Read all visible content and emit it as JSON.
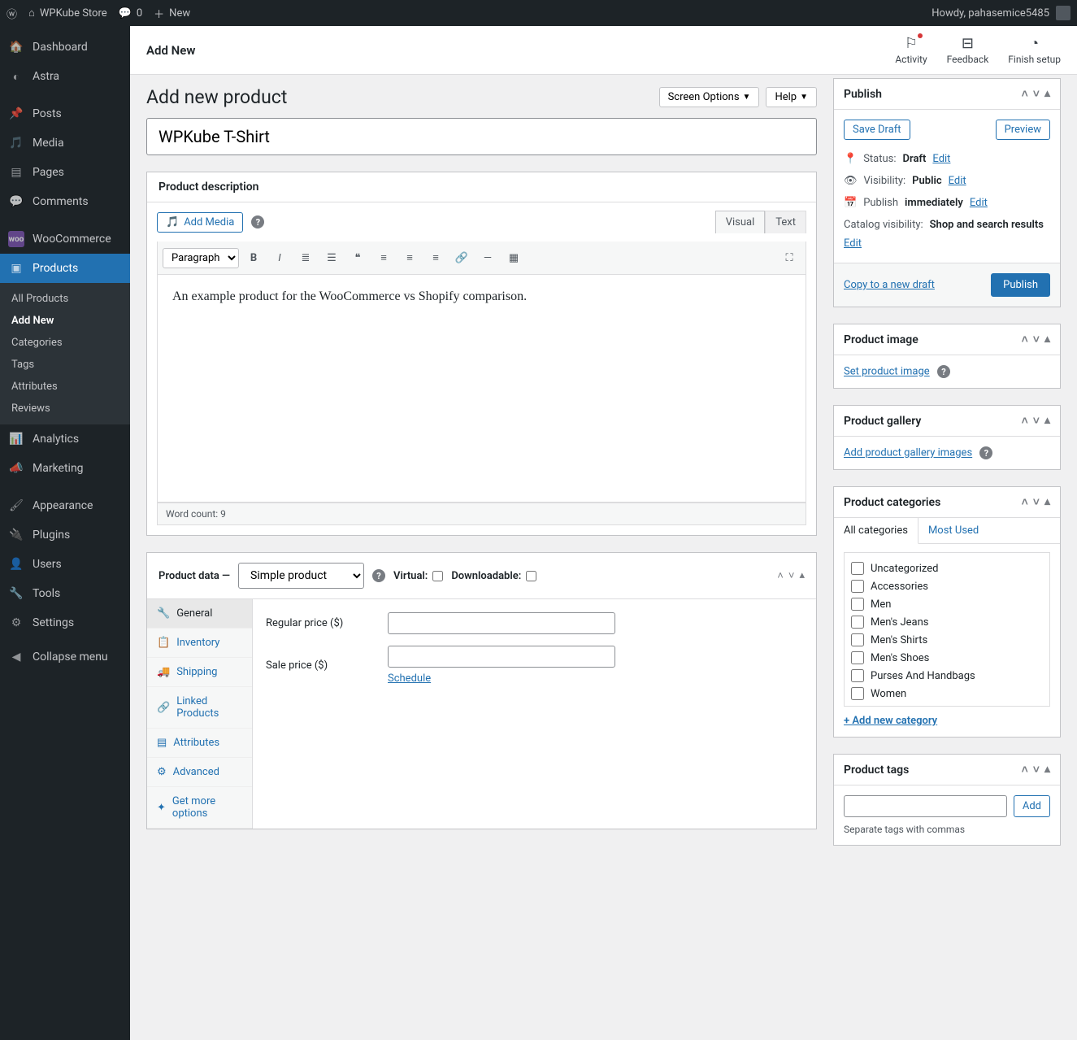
{
  "adminbar": {
    "site_name": "WPKube Store",
    "comments_count": "0",
    "new_label": "New",
    "howdy": "Howdy, pahasemice5485"
  },
  "sidebar": {
    "items": [
      {
        "label": "Dashboard",
        "icon": "⊞"
      },
      {
        "label": "Astra",
        "icon": "◐"
      },
      {
        "label": "Posts",
        "icon": "📌"
      },
      {
        "label": "Media",
        "icon": "🖼"
      },
      {
        "label": "Pages",
        "icon": "📄"
      },
      {
        "label": "Comments",
        "icon": "💬"
      },
      {
        "label": "WooCommerce",
        "icon": "W"
      },
      {
        "label": "Products",
        "icon": "▣"
      },
      {
        "label": "Analytics",
        "icon": "📊"
      },
      {
        "label": "Marketing",
        "icon": "📣"
      },
      {
        "label": "Appearance",
        "icon": "🖌"
      },
      {
        "label": "Plugins",
        "icon": "🔌"
      },
      {
        "label": "Users",
        "icon": "👤"
      },
      {
        "label": "Tools",
        "icon": "🔧"
      },
      {
        "label": "Settings",
        "icon": "⚙"
      }
    ],
    "products_sub": [
      "All Products",
      "Add New",
      "Categories",
      "Tags",
      "Attributes",
      "Reviews"
    ],
    "collapse": "Collapse menu"
  },
  "topbar": {
    "title": "Add New",
    "activity": "Activity",
    "feedback": "Feedback",
    "finish": "Finish setup"
  },
  "page": {
    "heading": "Add new product",
    "screen_options": "Screen Options",
    "help": "Help",
    "title_value": "WPKube T-Shirt"
  },
  "description": {
    "heading": "Product description",
    "add_media": "Add Media",
    "visual_tab": "Visual",
    "text_tab": "Text",
    "format_label": "Paragraph",
    "content": "An example product for the WooCommerce vs Shopify comparison.",
    "word_count_label": "Word count: 9"
  },
  "product_data": {
    "heading": "Product data —",
    "type_selected": "Simple product",
    "virtual_label": "Virtual:",
    "downloadable_label": "Downloadable:",
    "tabs": [
      "General",
      "Inventory",
      "Shipping",
      "Linked Products",
      "Attributes",
      "Advanced",
      "Get more options"
    ],
    "regular_price_label": "Regular price ($)",
    "sale_price_label": "Sale price ($)",
    "schedule": "Schedule"
  },
  "publish": {
    "heading": "Publish",
    "save_draft": "Save Draft",
    "preview": "Preview",
    "status_label": "Status:",
    "status_value": "Draft",
    "visibility_label": "Visibility:",
    "visibility_value": "Public",
    "publish_label": "Publish",
    "publish_value": "immediately",
    "catalog_label": "Catalog visibility:",
    "catalog_value": "Shop and search results",
    "edit": "Edit",
    "copy_draft": "Copy to a new draft",
    "publish_btn": "Publish"
  },
  "product_image": {
    "heading": "Product image",
    "set": "Set product image"
  },
  "gallery": {
    "heading": "Product gallery",
    "add": "Add product gallery images"
  },
  "categories": {
    "heading": "Product categories",
    "all_tab": "All categories",
    "most_used_tab": "Most Used",
    "items": [
      "Uncategorized",
      "Accessories",
      "Men",
      "Men's Jeans",
      "Men's Shirts",
      "Men's Shoes",
      "Purses And Handbags",
      "Women"
    ],
    "add_new": "+ Add new category"
  },
  "tags": {
    "heading": "Product tags",
    "add_btn": "Add",
    "helper": "Separate tags with commas"
  }
}
